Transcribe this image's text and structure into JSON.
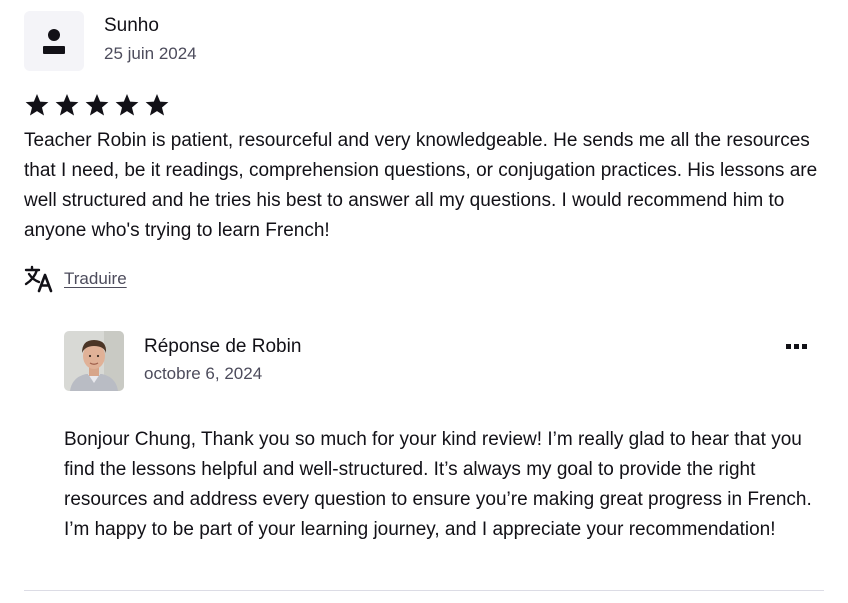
{
  "review": {
    "reviewer_name": "Sunho",
    "date": "25 juin 2024",
    "rating": 5,
    "text": "Teacher Robin is patient, resourceful and very knowledgeable. He sends me all the resources that I need, be it readings, comprehension questions, or conjugation practices. His lessons are well structured and he tries his best to answer all my questions. I would recommend him to anyone who's trying to learn French!",
    "translate_label": "Traduire",
    "avatar_icon": "user-silhouette-icon",
    "star_icon": "star-icon",
    "translate_icon": "translate-icon"
  },
  "response": {
    "title": "Réponse de Robin",
    "date": "octobre 6, 2024",
    "text": "Bonjour Chung, Thank you so much for your kind review! I’m really glad to hear that you find the lessons helpful and well-structured. It’s always my goal to provide the right resources and address every question to ensure you’re making great progress in French. I’m happy to be part of your learning journey, and I appreciate your recommendation!",
    "more_icon": "more-options-icon"
  },
  "colors": {
    "text_primary": "#121117",
    "text_secondary": "#4d4c5c",
    "avatar_bg": "#f4f4f8",
    "divider": "#dcdce5"
  }
}
